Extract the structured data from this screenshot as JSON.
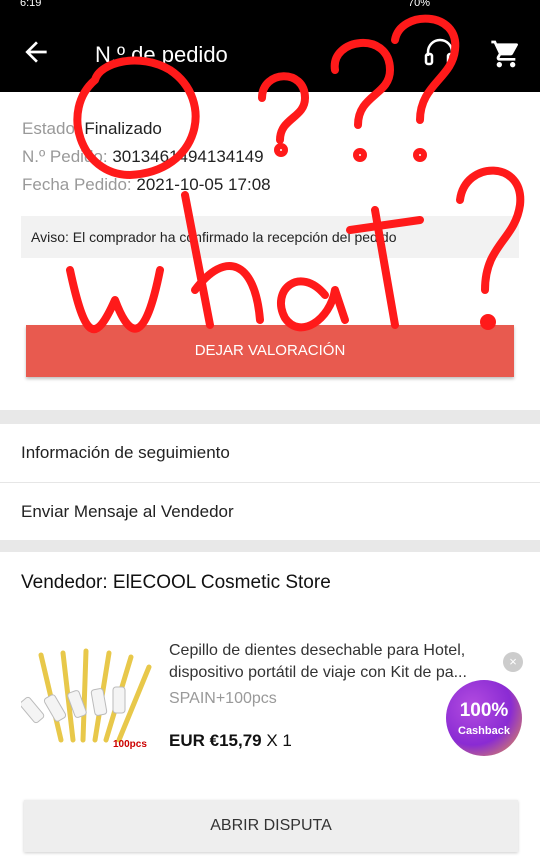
{
  "statusbar": {
    "time": "6:19",
    "battery": "70%"
  },
  "appbar": {
    "title": "N.º de pedido",
    "back_icon": "arrow-left-icon",
    "support_icon": "headset-icon",
    "cart_icon": "cart-icon"
  },
  "order": {
    "status_label": "Estado:",
    "status_value": "Finalizado",
    "number_label": "N.º Pedido:",
    "number_value": "3013461494134149",
    "date_label": "Fecha Pedido:",
    "date_value": "2021-10-05 17:08"
  },
  "notice": "Aviso: El comprador ha confirmado la recepción del pedido",
  "review_button": "DEJAR VALORACIÓN",
  "menu": {
    "tracking": "Información de seguimiento",
    "message_seller": "Enviar Mensaje al Vendedor"
  },
  "seller": "Vendedor: ElECOOL Cosmetic Store",
  "product": {
    "title_line1": "Cepillo de dientes desechable para Hotel,",
    "title_line2": "dispositivo portátil de viaje con Kit de pa...",
    "variant": "SPAIN+100pcs",
    "price": "EUR €15,79",
    "quantity": "X 1",
    "image_badge": "100pcs"
  },
  "cashback": {
    "percent": "100%",
    "label": "Cashback",
    "close": "×"
  },
  "dispute_button": "ABRIR DISPUTA",
  "annotation": {
    "text": "What ???",
    "color": "#ff1a1a"
  },
  "colors": {
    "appbar": "#000000",
    "review_button": "#e85a4f",
    "dispute_button": "#eeeeee"
  }
}
